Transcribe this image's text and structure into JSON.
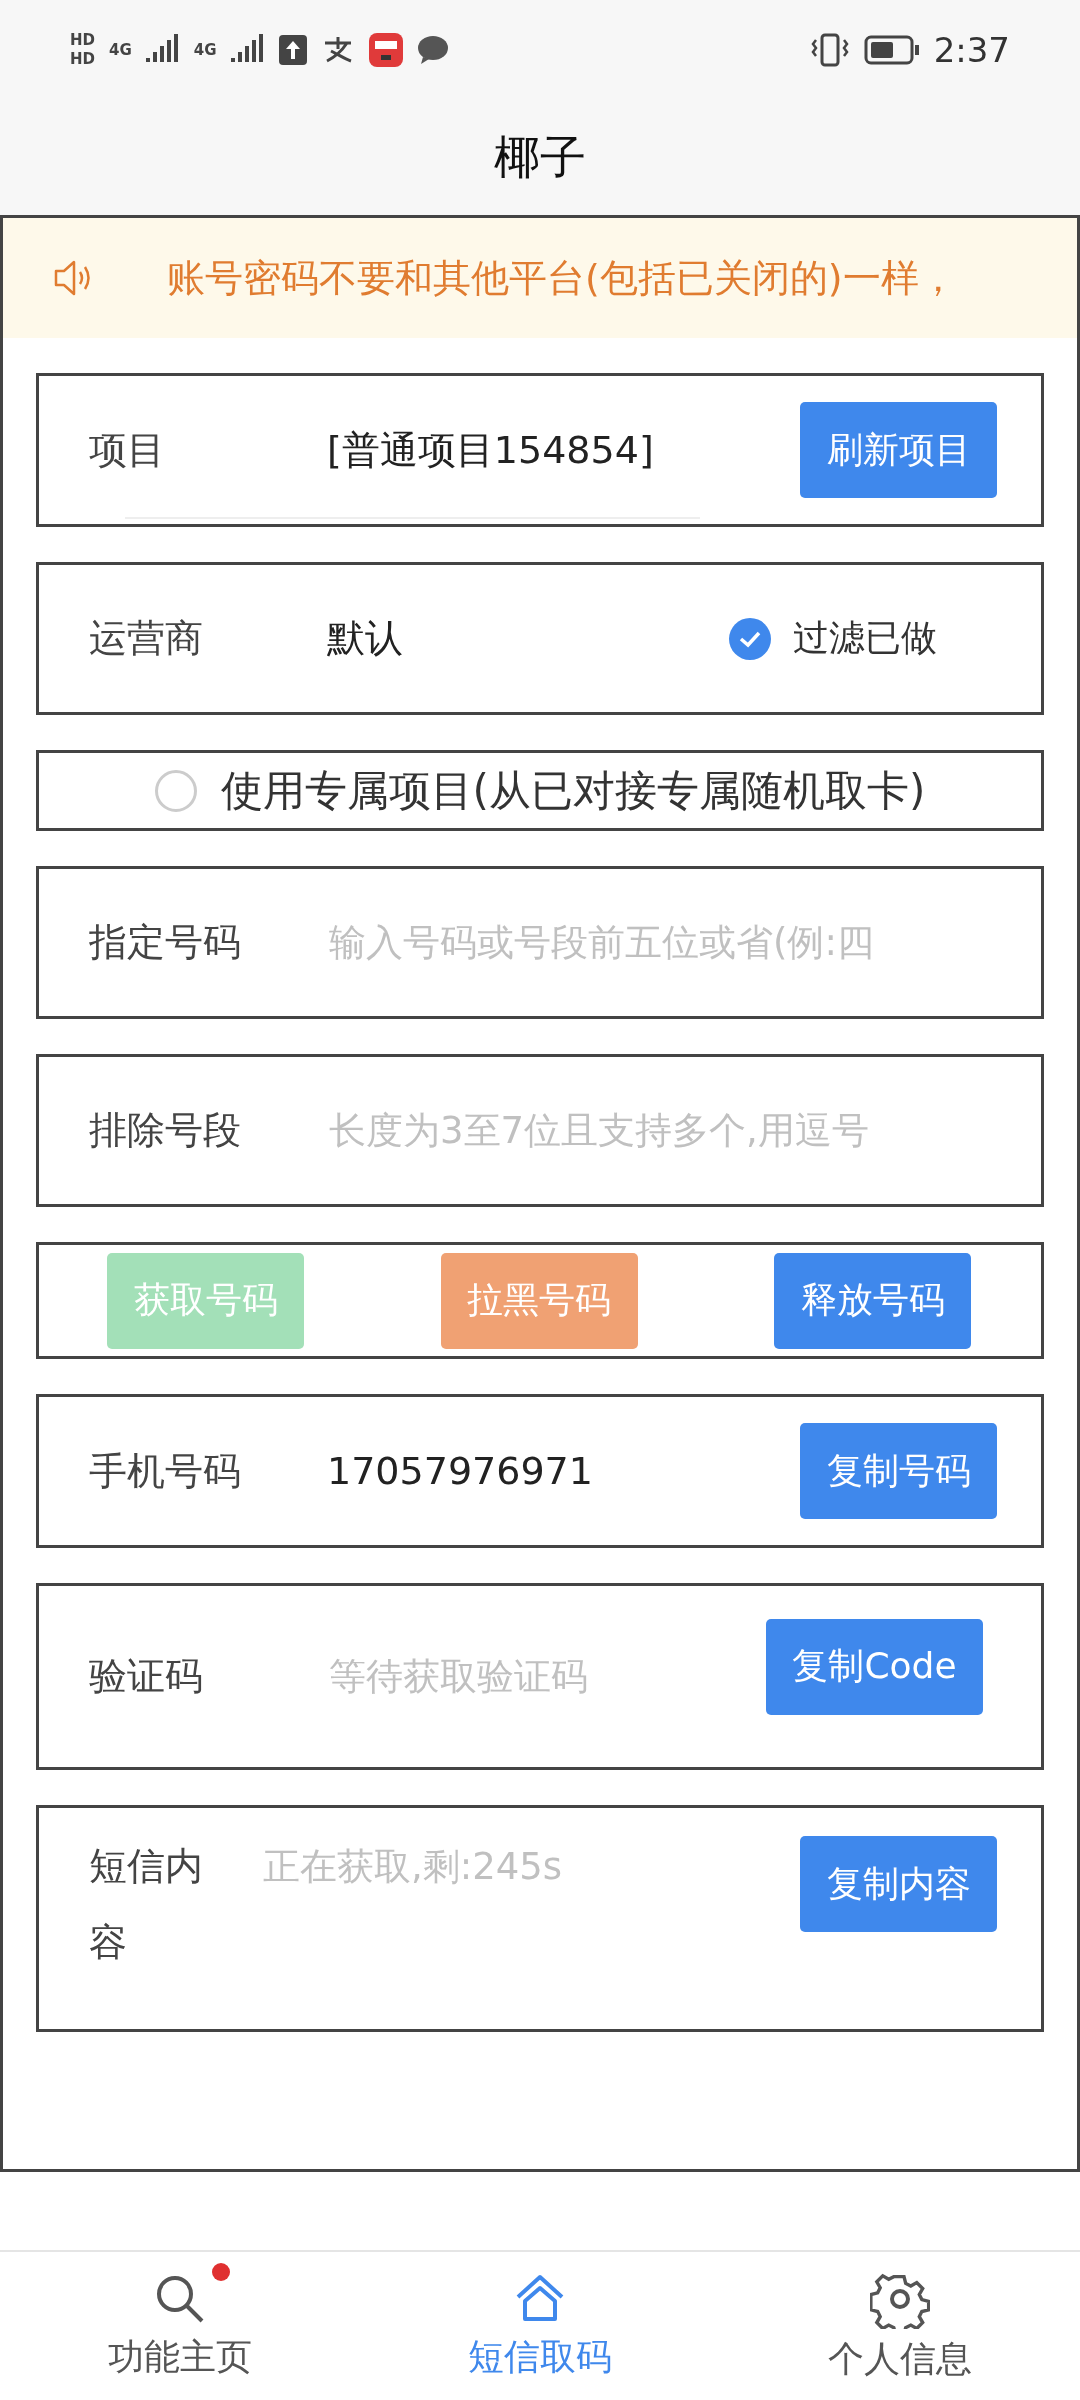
{
  "status_bar": {
    "sim_labels": [
      "HD",
      "HD"
    ],
    "network_labels": [
      "4G",
      "4G"
    ],
    "time": "2:37"
  },
  "header": {
    "title": "椰子"
  },
  "notice": {
    "text": "账号密码不要和其他平台(包括已关闭的)一样，"
  },
  "project": {
    "label": "项目",
    "value": "[普通项目154854]",
    "button": "刷新项目"
  },
  "operator": {
    "label": "运营商",
    "value": "默认",
    "filter": {
      "label": "过滤已做",
      "checked": true
    }
  },
  "exclusive": {
    "label": "使用专属项目(从已对接专属随机取卡)",
    "selected": false
  },
  "fields": [
    {
      "label": "指定号码",
      "placeholder": "输入号码或号段前五位或省(例:四"
    },
    {
      "label": "排除号段",
      "placeholder": "长度为3至7位且支持多个,用逗号"
    }
  ],
  "actions": [
    {
      "label": "获取号码",
      "color": "#a3e0b8"
    },
    {
      "label": "拉黑号码",
      "color": "#f0a173"
    },
    {
      "label": "释放号码",
      "color": "#3f88ec"
    }
  ],
  "phone": {
    "label": "手机号码",
    "value": "17057976971",
    "button": "复制号码"
  },
  "code": {
    "label": "验证码",
    "placeholder": "等待获取验证码",
    "button": "复制Code"
  },
  "sms": {
    "label": "短信内容",
    "placeholder": "正在获取,剩:245s",
    "button": "复制内容"
  },
  "tabs": [
    {
      "label": "功能主页",
      "selected": false,
      "badge": true
    },
    {
      "label": "短信取码",
      "selected": true,
      "badge": false
    },
    {
      "label": "个人信息",
      "selected": false,
      "badge": false
    }
  ]
}
